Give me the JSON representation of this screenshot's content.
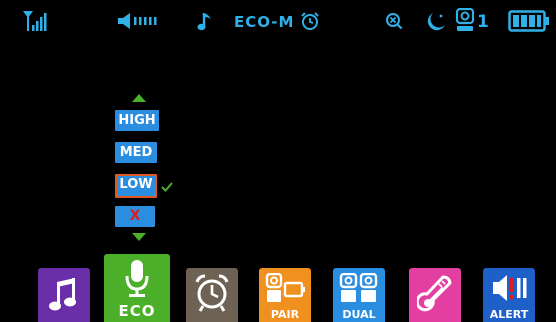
{
  "status_bar": {
    "eco_mode": "ECO-M",
    "camera_number": "1",
    "icons": [
      "signal-icon",
      "volume-icon",
      "music-note-icon",
      "alarm-clock-icon",
      "vox-icon",
      "night-mode-icon",
      "camera-icon",
      "battery-icon"
    ]
  },
  "sensitivity_menu": {
    "options": [
      "HIGH",
      "MED",
      "LOW",
      "X"
    ],
    "selected": "LOW",
    "colors": {
      "option_bg": "#2b8de0",
      "selected_border": "#e05a20",
      "check": "#4caf2a",
      "arrows": "#4caf2a",
      "off_x": "#e21b1b"
    }
  },
  "bottom_bar": {
    "tiles": [
      {
        "name": "music",
        "label": "",
        "color": "#6a2fa8"
      },
      {
        "name": "eco",
        "label": "ECO",
        "color": "#4caf2a"
      },
      {
        "name": "alarm",
        "label": "",
        "color": "#6e6254"
      },
      {
        "name": "pair",
        "label": "PAIR",
        "color": "#f0901e"
      },
      {
        "name": "dual",
        "label": "DUAL",
        "color": "#2b8de0"
      },
      {
        "name": "temperature",
        "label": "",
        "color": "#e23fa0"
      },
      {
        "name": "alert",
        "label": "ALERT",
        "color": "#1f5fc8"
      }
    ]
  },
  "colors": {
    "status_icons": "#2fb0e6",
    "background": "#000000"
  }
}
